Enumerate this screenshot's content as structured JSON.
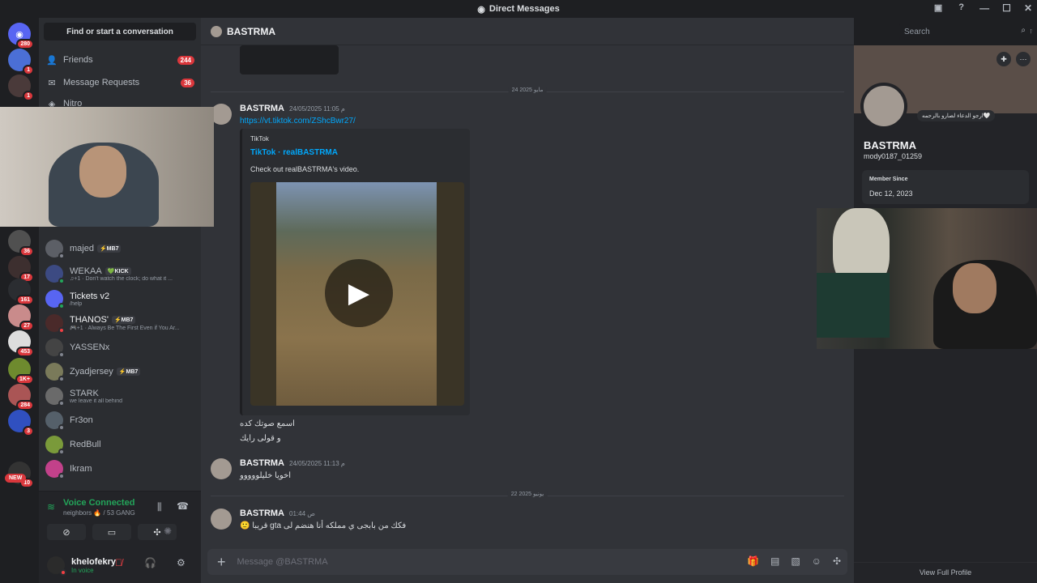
{
  "window": {
    "title": "Direct Messages"
  },
  "guilds": [
    {
      "badge": "280"
    },
    {
      "badge": "1"
    },
    {
      "badge": "1"
    },
    {
      "badge": "36"
    },
    {
      "badge": "17"
    },
    {
      "badge": "161"
    },
    {
      "badge": "27"
    },
    {
      "badge": "453"
    },
    {
      "badge": "1K+"
    },
    {
      "badge": "284"
    },
    {
      "badge": "3"
    },
    {
      "badge": "10"
    }
  ],
  "guild_new_label": "NEW",
  "dm_sidebar": {
    "find_label": "Find or start a conversation",
    "nav": [
      {
        "label": "Friends",
        "count": "244"
      },
      {
        "label": "Message Requests",
        "count": "36"
      },
      {
        "label": "Nitro",
        "count": ""
      }
    ],
    "dms": [
      {
        "name": "majed",
        "tag": "⚡MB7",
        "sub": ""
      },
      {
        "name": "WEKAA",
        "tag": "💚KICK",
        "sub": "♫+1 · Don't watch the clock; do what it ..."
      },
      {
        "name": "Tickets v2",
        "tag": "",
        "sub": "/help"
      },
      {
        "name": "THANOS'",
        "tag": "⚡MB7",
        "sub": "🎮+1 · Always Be The First Even if You Ar..."
      },
      {
        "name": "YASSENx",
        "tag": "",
        "sub": ""
      },
      {
        "name": "Zyadjersey",
        "tag": "⚡MB7",
        "sub": ""
      },
      {
        "name": "STARK",
        "tag": "",
        "sub": "we leave it all behind"
      },
      {
        "name": "Fr3on",
        "tag": "",
        "sub": ""
      },
      {
        "name": "RedBull",
        "tag": "",
        "sub": ""
      },
      {
        "name": "Ikram",
        "tag": "",
        "sub": ""
      }
    ]
  },
  "voice": {
    "status": "Voice Connected",
    "channel": "neighbors 🔥 / 53 GANG"
  },
  "user": {
    "name": "khelofekry",
    "status": "In voice"
  },
  "header": {
    "name": "BASTRMA",
    "search_placeholder": "Search"
  },
  "messages": {
    "divider1": "24 مايو 2025",
    "m1": {
      "author": "BASTRMA",
      "time": "24/05/2025 11:05 م",
      "link": "https://vt.tiktok.com/ZShcBwr27/"
    },
    "embed": {
      "provider": "TikTok",
      "title": "TikTok · realBASTRMA",
      "desc": "Check out realBASTRMA's video."
    },
    "m1_line1": "اسمع صوتك كده",
    "m1_line2": "و قولى رايك",
    "m2": {
      "author": "BASTRMA",
      "time": "24/05/2025 11:13 م",
      "text": "اخويا خليلووووو"
    },
    "divider2": "22 يونيو 2025",
    "m3": {
      "author": "BASTRMA",
      "time": "01:44 ص",
      "text": "🙂 قريبا gta فكك من بابجى ي مملكه أنا هنضم لى"
    }
  },
  "composer": {
    "placeholder": "Message @BASTRMA"
  },
  "profile": {
    "status": "ارجو الدعاء لصارو بالرحمه🤍",
    "name": "BASTRMA",
    "username": "mody0187_01259",
    "member_since_label": "Member Since",
    "member_since": "Dec 12, 2023",
    "view_full": "View Full Profile"
  }
}
